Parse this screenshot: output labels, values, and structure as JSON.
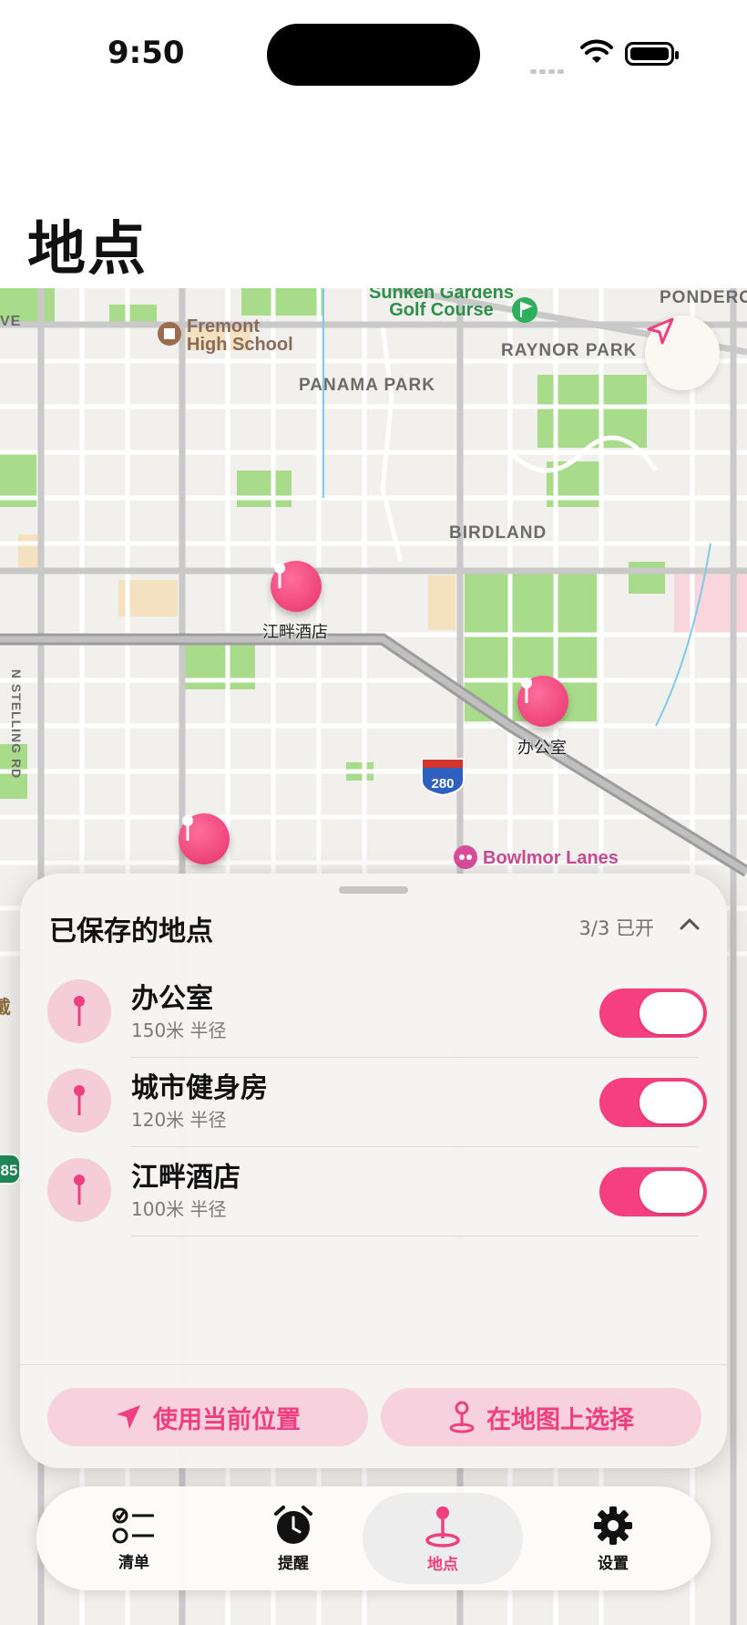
{
  "status_bar": {
    "time": "9:50"
  },
  "page_title": "地点",
  "map": {
    "labels": {
      "ponderosa": "PONDEROS",
      "raynor_park": "RAYNOR PARK",
      "panama_park": "PANAMA PARK",
      "birdland": "BIRDLAND",
      "stelling_rd": "N STELLING RD",
      "ve": "VE",
      "fremont_line1": "Fremont",
      "fremont_line2": "High School",
      "sunken_line1": "Sunken Gardens",
      "sunken_line2": "Golf Course",
      "bowlmor": "Bowlmor Lanes",
      "highway_280": "280",
      "highway_85": "85",
      "edge_text": "戴"
    },
    "pins": [
      {
        "label": "江畔酒店"
      },
      {
        "label": "办公室"
      },
      {
        "label": ""
      }
    ]
  },
  "saved_locations": {
    "title": "已保存的地点",
    "count_text": "3/3 已开",
    "items": [
      {
        "name": "办公室",
        "subtitle": "150米 半径",
        "enabled": true
      },
      {
        "name": "城市健身房",
        "subtitle": "120米 半径",
        "enabled": true
      },
      {
        "name": "江畔酒店",
        "subtitle": "100米 半径",
        "enabled": true
      }
    ],
    "use_current_location": "使用当前位置",
    "choose_on_map": "在地图上选择"
  },
  "tabs": [
    {
      "label": "清单",
      "icon": "checklist-icon",
      "active": false
    },
    {
      "label": "提醒",
      "icon": "alarm-clock-icon",
      "active": false
    },
    {
      "label": "地点",
      "icon": "map-pin-icon",
      "active": true
    },
    {
      "label": "设置",
      "icon": "gear-icon",
      "active": false
    }
  ],
  "colors": {
    "accent": "#F63F7F",
    "accent_light": "#F7D1DD",
    "park": "#A8DC8A"
  }
}
